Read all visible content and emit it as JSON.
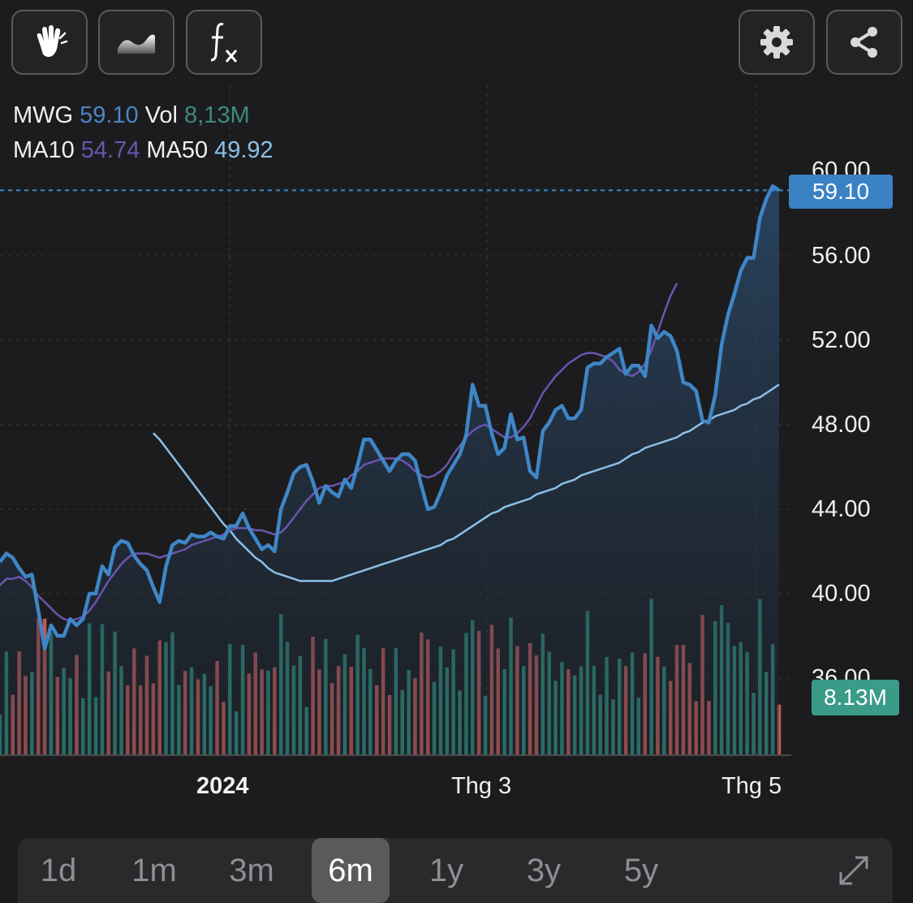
{
  "toolbar": {
    "left_icons": [
      "hand-draw-icon",
      "area-wave-icon",
      "function-fx-icon"
    ],
    "right_icons": [
      "gear-icon",
      "share-icon"
    ]
  },
  "legend": {
    "ticker": "MWG",
    "price": "59.10",
    "vol_label": "Vol",
    "vol_value": "8,13M",
    "ma10_label": "MA10",
    "ma10_value": "54.74",
    "ma50_label": "MA50",
    "ma50_value": "49.92"
  },
  "badges": {
    "price": "59.10",
    "volume": "8.13M"
  },
  "ranges": {
    "options": [
      "1d",
      "1m",
      "3m",
      "6m",
      "1y",
      "3y",
      "5y"
    ],
    "selected": "6m"
  },
  "colors": {
    "price_line": "#3f86c6",
    "ma10_line": "#6a55b0",
    "ma50_line": "#8cc0e8",
    "vol_up": "#2f8a79",
    "vol_down": "#c05a58",
    "badge_price": "#3b82c4",
    "badge_volume": "#3a9b88"
  },
  "chart_data": {
    "type": "line",
    "title": "",
    "ylim": [
      36,
      60
    ],
    "yticks": [
      "60.00",
      "56.00",
      "52.00",
      "48.00",
      "44.00",
      "40.00",
      "36.00"
    ],
    "x_labels": [
      "2024",
      "Thg 3",
      "Thg 5"
    ],
    "last_price": 59.1,
    "series": [
      {
        "name": "MWG",
        "values": [
          41.5,
          41.9,
          41.7,
          41.2,
          40.8,
          40.9,
          39.2,
          37.4,
          38.5,
          38.0,
          38.0,
          38.8,
          38.5,
          38.8,
          40.0,
          40.0,
          41.3,
          40.9,
          42.2,
          42.5,
          42.4,
          41.8,
          41.4,
          41.1,
          40.3,
          39.6,
          41.3,
          42.3,
          42.5,
          42.4,
          42.8,
          42.7,
          42.7,
          42.9,
          42.7,
          42.6,
          43.2,
          43.2,
          43.8,
          43.1,
          42.6,
          42.1,
          42.3,
          42.0,
          44.0,
          44.8,
          45.7,
          46.0,
          46.1,
          45.3,
          44.3,
          45.1,
          44.8,
          44.6,
          45.4,
          45.0,
          46.1,
          47.3,
          47.3,
          46.8,
          46.3,
          45.8,
          46.3,
          46.6,
          46.6,
          46.3,
          45.1,
          44.0,
          44.1,
          44.8,
          45.6,
          46.1,
          46.6,
          47.5,
          49.9,
          48.9,
          48.9,
          47.6,
          46.6,
          46.9,
          48.5,
          47.3,
          47.4,
          45.8,
          45.5,
          47.7,
          48.1,
          48.7,
          48.9,
          48.3,
          48.3,
          48.7,
          50.7,
          50.9,
          50.9,
          51.2,
          51.4,
          51.6,
          50.4,
          50.8,
          50.8,
          50.3,
          52.7,
          52.1,
          52.4,
          52.2,
          51.5,
          50.0,
          49.9,
          49.6,
          48.2,
          48.1,
          49.4,
          51.8,
          53.2,
          54.2,
          55.3,
          55.9,
          55.9,
          57.8,
          58.7,
          59.3,
          59.1
        ]
      },
      {
        "name": "MA10",
        "values": [
          40.4,
          40.7,
          40.7,
          40.8,
          40.6,
          40.3,
          39.9,
          39.6,
          39.3,
          39.0,
          38.8,
          38.7,
          38.8,
          38.9,
          39.2,
          39.6,
          40.1,
          40.6,
          41.0,
          41.4,
          41.7,
          41.9,
          41.9,
          41.9,
          41.8,
          41.7,
          41.8,
          41.9,
          42.0,
          42.1,
          42.3,
          42.4,
          42.5,
          42.6,
          42.7,
          42.8,
          43.0,
          43.1,
          43.1,
          43.1,
          43.0,
          43.0,
          42.9,
          42.8,
          42.9,
          43.2,
          43.6,
          44.0,
          44.4,
          44.7,
          45.0,
          45.1,
          45.1,
          45.2,
          45.3,
          45.6,
          45.8,
          46.1,
          46.2,
          46.3,
          46.4,
          46.4,
          46.4,
          46.3,
          46.1,
          45.8,
          45.6,
          45.5,
          45.6,
          45.8,
          46.1,
          46.6,
          47.0,
          47.4,
          47.7,
          47.9,
          48.0,
          47.8,
          47.6,
          47.4,
          47.4,
          47.6,
          47.9,
          48.3,
          48.9,
          49.5,
          49.9,
          50.3,
          50.6,
          50.9,
          51.1,
          51.3,
          51.4,
          51.4,
          51.3,
          51.2,
          51.0,
          50.6,
          50.4,
          50.3,
          50.5,
          50.9,
          51.5,
          52.4,
          53.3,
          54.1,
          54.7
        ]
      },
      {
        "name": "MA50",
        "values": [
          47.6,
          47.3,
          46.9,
          46.5,
          46.1,
          45.7,
          45.3,
          44.9,
          44.5,
          44.1,
          43.7,
          43.3,
          43.0,
          42.6,
          42.3,
          42.0,
          41.7,
          41.5,
          41.2,
          41.0,
          40.9,
          40.8,
          40.7,
          40.6,
          40.6,
          40.6,
          40.6,
          40.6,
          40.6,
          40.7,
          40.8,
          40.9,
          41.0,
          41.1,
          41.2,
          41.3,
          41.4,
          41.5,
          41.6,
          41.7,
          41.8,
          41.9,
          42.0,
          42.1,
          42.2,
          42.3,
          42.5,
          42.6,
          42.8,
          43.0,
          43.2,
          43.4,
          43.6,
          43.8,
          43.9,
          44.1,
          44.2,
          44.3,
          44.4,
          44.5,
          44.7,
          44.8,
          44.9,
          45.0,
          45.2,
          45.3,
          45.4,
          45.6,
          45.7,
          45.8,
          45.9,
          46.0,
          46.1,
          46.2,
          46.4,
          46.6,
          46.7,
          46.9,
          47.0,
          47.1,
          47.2,
          47.3,
          47.4,
          47.6,
          47.7,
          47.9,
          48.1,
          48.2,
          48.4,
          48.5,
          48.6,
          48.7,
          48.9,
          49.0,
          49.2,
          49.3,
          49.5,
          49.7,
          49.9
        ]
      },
      {
        "name": "Vol",
        "values": []
      }
    ]
  }
}
